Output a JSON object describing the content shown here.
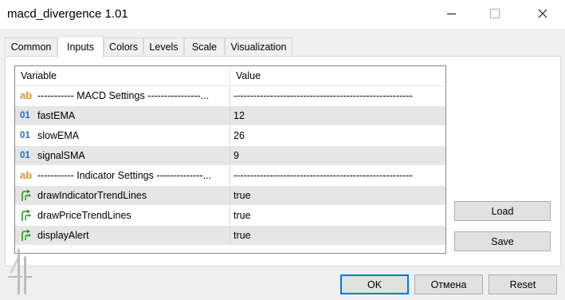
{
  "window": {
    "title": "macd_divergence 1.01",
    "controls": [
      "minimize-icon",
      "maximize-icon",
      "close-icon"
    ]
  },
  "tabs": [
    {
      "label": "Common",
      "active": false
    },
    {
      "label": "Inputs",
      "active": true
    },
    {
      "label": "Colors",
      "active": false
    },
    {
      "label": "Levels",
      "active": false
    },
    {
      "label": "Scale",
      "active": false
    },
    {
      "label": "Visualization",
      "active": false
    }
  ],
  "grid": {
    "headers": {
      "variable": "Variable",
      "value": "Value"
    },
    "rows": [
      {
        "icon": "ab",
        "variable": "----------- MACD Settings ----------------...",
        "value": "------------------------------------------------------",
        "shaded": false
      },
      {
        "icon": "01",
        "variable": "fastEMA",
        "value": "12",
        "shaded": true
      },
      {
        "icon": "01",
        "variable": "slowEMA",
        "value": "26",
        "shaded": false
      },
      {
        "icon": "01",
        "variable": "signalSMA",
        "value": "9",
        "shaded": true
      },
      {
        "icon": "ab",
        "variable": "----------- Indicator Settings --------------...",
        "value": "------------------------------------------------------",
        "shaded": false
      },
      {
        "icon": "arrow",
        "variable": "drawIndicatorTrendLines",
        "value": "true",
        "shaded": true
      },
      {
        "icon": "arrow",
        "variable": "drawPriceTrendLines",
        "value": "true",
        "shaded": false
      },
      {
        "icon": "arrow",
        "variable": "displayAlert",
        "value": "true",
        "shaded": true
      }
    ]
  },
  "side_buttons": {
    "load": "Load",
    "save": "Save"
  },
  "footer_buttons": {
    "ok": "OK",
    "cancel": "Отмена",
    "reset": "Reset"
  },
  "colors": {
    "accent": "#0078d7",
    "string_icon": "#d09a2a",
    "int_icon": "#1e6fbf",
    "bool_icon": "#1a9a1a"
  }
}
